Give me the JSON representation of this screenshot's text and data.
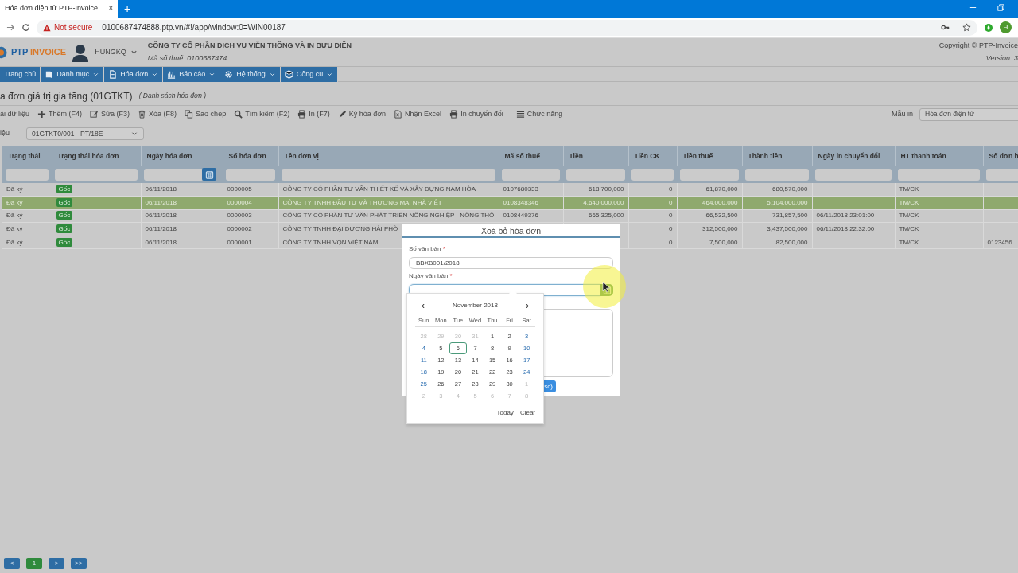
{
  "browser": {
    "tab_title": "Hóa đơn điện tử PTP-Invoice",
    "close": "×",
    "new_tab": "+",
    "security": "Not secure",
    "url": "0100687474888.ptp.vn/#!/app/window:0=WIN00187",
    "avatar": "H"
  },
  "app": {
    "brand_a": "PTP",
    "brand_b": "INVOICE",
    "user": "HUNGKQ",
    "company": "CÔNG TY CỔ PHẦN DỊCH VỤ VIỄN THÔNG VÀ IN BƯU ĐIỆN",
    "tax_id": "Mã số thuế: 0100687474",
    "copyright": "Copyright © PTP-Invoice",
    "version": "Version: 3"
  },
  "menu": [
    {
      "label": "Trang chủ",
      "dropdown": false
    },
    {
      "label": "Danh mục",
      "dropdown": true
    },
    {
      "label": "Hóa đơn",
      "dropdown": true
    },
    {
      "label": "Báo cáo",
      "dropdown": true
    },
    {
      "label": "Hệ thống",
      "dropdown": true
    },
    {
      "label": "Công cụ",
      "dropdown": true
    }
  ],
  "page_title": "a đơn giá trị gia tăng (01GTKT)",
  "page_subtitle": "( Danh sách hóa đơn )",
  "toolbar": [
    "ải dữ liệu",
    "Thêm (F4)",
    "Sửa (F3)",
    "Xóa (F8)",
    "Sao chép",
    "Tìm kiếm (F2)",
    "In (F7)",
    "Ký hóa đơn",
    "Nhận Excel",
    "In chuyển đổi",
    "Chức năng"
  ],
  "print_template": {
    "label": "Mẫu in",
    "value": "Hóa đơn điện tử"
  },
  "series": {
    "label": "iệu",
    "value": "01GTKT0/001 - PT/18E"
  },
  "table": {
    "columns": [
      {
        "label": "Trạng thái",
        "kind": "text"
      },
      {
        "label": "Trạng thái hóa đơn",
        "kind": "badge"
      },
      {
        "label": "Ngày hóa đơn",
        "kind": "date"
      },
      {
        "label": "Số hóa đơn",
        "kind": "text"
      },
      {
        "label": "Tên đơn vị",
        "kind": "text"
      },
      {
        "label": "Mã số thuế",
        "kind": "text"
      },
      {
        "label": "Tiền",
        "kind": "number"
      },
      {
        "label": "Tiền CK",
        "kind": "number"
      },
      {
        "label": "Tiền thuế",
        "kind": "number"
      },
      {
        "label": "Thành tiền",
        "kind": "number"
      },
      {
        "label": "Ngày in chuyển đổi",
        "kind": "text"
      },
      {
        "label": "HT thanh toán",
        "kind": "text"
      },
      {
        "label": "Số đơn h",
        "kind": "text"
      }
    ],
    "rows": [
      {
        "selected": false,
        "cells": [
          "Đã ký",
          "Gốc",
          "06/11/2018",
          "0000005",
          "CÔNG TY CỔ PHẦN TƯ VẤN THIẾT KẾ VÀ XÂY DỰNG NAM HÒA",
          "0107680333",
          "618,700,000",
          "0",
          "61,870,000",
          "680,570,000",
          null,
          "TM/CK",
          null
        ]
      },
      {
        "selected": true,
        "cells": [
          "Đã ký",
          "Gốc",
          "06/11/2018",
          "0000004",
          "CÔNG TY TNHH ĐẦU TƯ VÀ THƯƠNG MẠI NHÀ VIỆT",
          "0108348346",
          "4,640,000,000",
          "0",
          "464,000,000",
          "5,104,000,000",
          null,
          "TM/CK",
          null
        ]
      },
      {
        "selected": false,
        "cells": [
          "Đã ký",
          "Gốc",
          "06/11/2018",
          "0000003",
          "CÔNG TY CỔ PHẦN TƯ VẤN PHÁT TRIỂN NÔNG NGHIỆP - NÔNG THÔ",
          "0108449376",
          "665,325,000",
          "0",
          "66,532,500",
          "731,857,500",
          "06/11/2018 23:01:00",
          "TM/CK",
          null
        ]
      },
      {
        "selected": false,
        "cells": [
          "Đã ký",
          "Gốc",
          "06/11/2018",
          "0000002",
          "CÔNG TY TNHH ĐẠI DƯƠNG HẢI PHÒ",
          null,
          null,
          "0",
          "312,500,000",
          "3,437,500,000",
          "06/11/2018 22:32:00",
          "TM/CK",
          null
        ]
      },
      {
        "selected": false,
        "cells": [
          "Đã ký",
          "Gốc",
          "06/11/2018",
          "0000001",
          "CÔNG TY TNHH VỌN VIỆT NAM",
          null,
          null,
          "0",
          "7,500,000",
          "82,500,000",
          null,
          "TM/CK",
          "0123456"
        ]
      }
    ]
  },
  "pagination": [
    {
      "label": "<",
      "selected": false
    },
    {
      "label": "1",
      "selected": true
    },
    {
      "label": ">",
      "selected": false
    },
    {
      "label": ">>",
      "selected": false
    }
  ],
  "dialog": {
    "title": "Xoá bỏ hóa đơn",
    "fields": [
      {
        "label": "Số văn bản",
        "required_mark": "*",
        "kind": "text",
        "value": "BBXB001/2018",
        "focused": false
      },
      {
        "label": "Ngày văn bản",
        "required_mark": "*",
        "kind": "date",
        "focused": true
      }
    ],
    "button": "sc)"
  },
  "calendar": {
    "prev": "‹",
    "next": "›",
    "month": "November 2018",
    "weekdays": [
      "Sun",
      "Mon",
      "Tue",
      "Wed",
      "Thu",
      "Fri",
      "Sat"
    ],
    "days": [
      {
        "label": "28",
        "muted": true,
        "today": false
      },
      {
        "label": "29",
        "muted": true,
        "today": false
      },
      {
        "label": "30",
        "muted": true,
        "today": false
      },
      {
        "label": "31",
        "muted": true,
        "today": false
      },
      {
        "label": "1",
        "muted": false,
        "today": false
      },
      {
        "label": "2",
        "muted": false,
        "today": false
      },
      {
        "label": "3",
        "muted": false,
        "today": false
      },
      {
        "label": "4",
        "muted": false,
        "today": false
      },
      {
        "label": "5",
        "muted": false,
        "today": false
      },
      {
        "label": "6",
        "muted": false,
        "today": true
      },
      {
        "label": "7",
        "muted": false,
        "today": false
      },
      {
        "label": "8",
        "muted": false,
        "today": false
      },
      {
        "label": "9",
        "muted": false,
        "today": false
      },
      {
        "label": "10",
        "muted": false,
        "today": false
      },
      {
        "label": "11",
        "muted": false,
        "today": false
      },
      {
        "label": "12",
        "muted": false,
        "today": false
      },
      {
        "label": "13",
        "muted": false,
        "today": false
      },
      {
        "label": "14",
        "muted": false,
        "today": false
      },
      {
        "label": "15",
        "muted": false,
        "today": false
      },
      {
        "label": "16",
        "muted": false,
        "today": false
      },
      {
        "label": "17",
        "muted": false,
        "today": false
      },
      {
        "label": "18",
        "muted": false,
        "today": false
      },
      {
        "label": "19",
        "muted": false,
        "today": false
      },
      {
        "label": "20",
        "muted": false,
        "today": false
      },
      {
        "label": "21",
        "muted": false,
        "today": false
      },
      {
        "label": "22",
        "muted": false,
        "today": false
      },
      {
        "label": "23",
        "muted": false,
        "today": false
      },
      {
        "label": "24",
        "muted": false,
        "today": false
      },
      {
        "label": "25",
        "muted": false,
        "today": false
      },
      {
        "label": "26",
        "muted": false,
        "today": false
      },
      {
        "label": "27",
        "muted": false,
        "today": false
      },
      {
        "label": "28",
        "muted": false,
        "today": false
      },
      {
        "label": "29",
        "muted": false,
        "today": false
      },
      {
        "label": "30",
        "muted": false,
        "today": false
      },
      {
        "label": "1",
        "muted": true,
        "today": false
      },
      {
        "label": "2",
        "muted": true,
        "today": false
      },
      {
        "label": "3",
        "muted": true,
        "today": false
      },
      {
        "label": "4",
        "muted": true,
        "today": false
      },
      {
        "label": "5",
        "muted": true,
        "today": false
      },
      {
        "label": "6",
        "muted": true,
        "today": false
      },
      {
        "label": "7",
        "muted": true,
        "today": false
      },
      {
        "label": "8",
        "muted": true,
        "today": false
      }
    ],
    "buttons": [
      "Today",
      "Clear"
    ]
  }
}
